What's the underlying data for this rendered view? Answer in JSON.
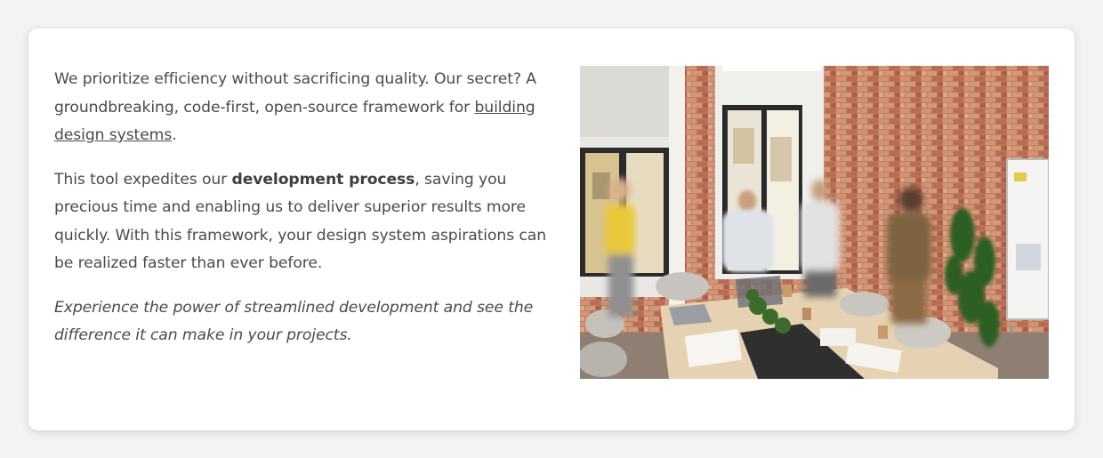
{
  "content": {
    "p1_text_a": "We prioritize efficiency without sacrificing quality. Our secret? A groundbreaking, code-first, open-source framework for ",
    "p1_link": "building design systems",
    "p1_text_b": ".",
    "p2_text_a": "This tool expedites our ",
    "p2_bold": "development process",
    "p2_text_b": ", saving you precious time and enabling us to deliver superior results more quickly. With this framework, your design system aspirations can be realized faster than ever before.",
    "p3_italic": "Experience the power of streamlined development and see the difference it can make in your projects."
  },
  "image": {
    "subject": "office-meeting-photo",
    "colors": {
      "brick": "#c0775a",
      "wall": "#eceae6",
      "window_frame": "#2d2d2d",
      "table": "#e7d3b4",
      "plant": "#3d6b2c"
    }
  }
}
